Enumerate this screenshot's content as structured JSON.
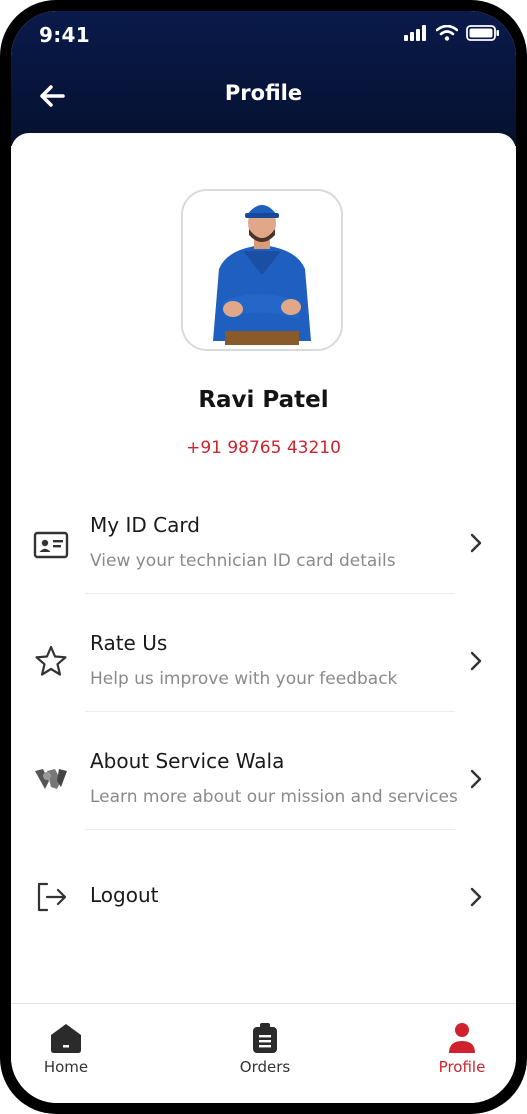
{
  "status_bar": {
    "time": "9:41"
  },
  "header": {
    "title": "Profile"
  },
  "profile": {
    "name": "Ravi Patel",
    "phone": "+91 98765 43210"
  },
  "menu": [
    {
      "title": "My ID Card",
      "subtitle": "View your technician ID card details",
      "icon": "id-card-icon"
    },
    {
      "title": "Rate Us",
      "subtitle": "Help us improve with your feedback",
      "icon": "star-icon"
    },
    {
      "title": "About Service Wala",
      "subtitle": "Learn more about our mission and services",
      "icon": "service-wala-logo-icon"
    },
    {
      "title": "Logout",
      "icon": "logout-icon"
    }
  ],
  "bottom_nav": [
    {
      "label": "Home",
      "icon": "home-icon",
      "active": false
    },
    {
      "label": "Orders",
      "icon": "clipboard-icon",
      "active": false
    },
    {
      "label": "Profile",
      "icon": "user-icon",
      "active": true
    }
  ],
  "colors": {
    "header_bg": "#0a1a4a",
    "accent_red": "#d0222c",
    "text_dark": "#1a1a1a",
    "text_muted": "#8a8a8a"
  }
}
